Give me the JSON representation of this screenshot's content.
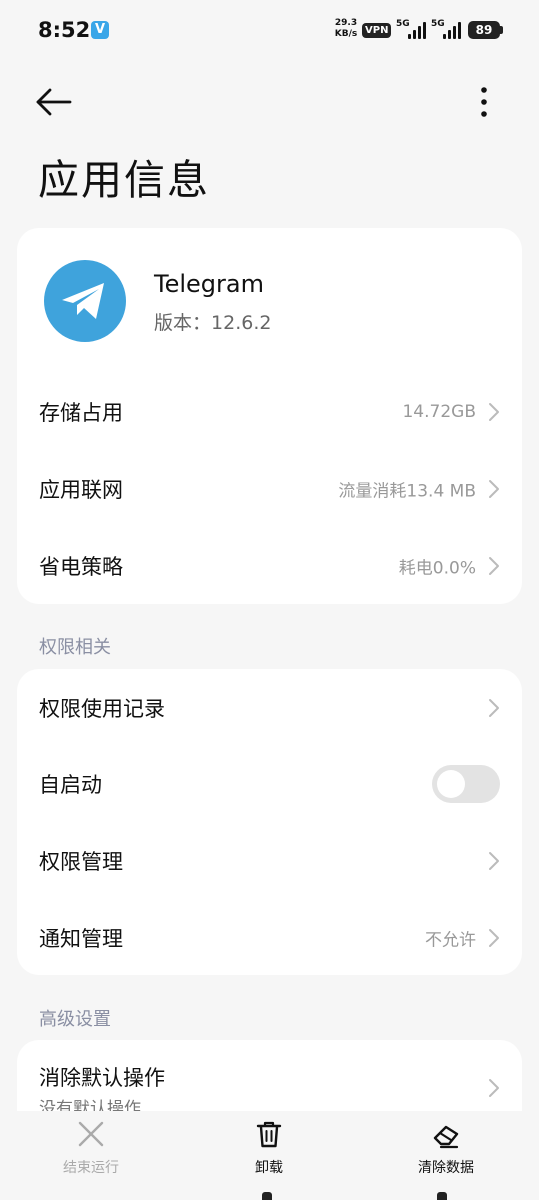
{
  "status_bar": {
    "time": "8:52",
    "app_badge": "V",
    "net_speed_value": "29.3",
    "net_speed_unit": "KB/s",
    "vpn": "VPN",
    "sim1_gen": "5G",
    "sim2_gen": "5G",
    "battery": "89"
  },
  "header": {
    "back_icon": "arrow-left-icon",
    "more_icon": "more-vertical-icon",
    "title": "应用信息"
  },
  "app": {
    "icon": "telegram-logo",
    "brand_color": "#3fa3dc",
    "name": "Telegram",
    "version_label": "版本：",
    "version": "12.6.2"
  },
  "usage_rows": [
    {
      "label": "存储占用",
      "value": "14.72GB"
    },
    {
      "label": "应用联网",
      "value": "流量消耗13.4 MB"
    },
    {
      "label": "省电策略",
      "value": "耗电0.0%"
    }
  ],
  "permissions": {
    "section_title": "权限相关",
    "usage_record": {
      "label": "权限使用记录"
    },
    "autostart": {
      "label": "自启动",
      "enabled": false
    },
    "manage": {
      "label": "权限管理"
    },
    "notifications": {
      "label": "通知管理",
      "value": "不允许"
    }
  },
  "advanced": {
    "section_title": "高级设置",
    "clear_defaults": {
      "label": "消除默认操作",
      "subtitle": "没有默认操作"
    }
  },
  "bottom_actions": [
    {
      "label": "结束运行",
      "icon": "close-icon",
      "enabled": false
    },
    {
      "label": "卸载",
      "icon": "trash-icon",
      "enabled": true
    },
    {
      "label": "清除数据",
      "icon": "eraser-icon",
      "enabled": true
    }
  ]
}
